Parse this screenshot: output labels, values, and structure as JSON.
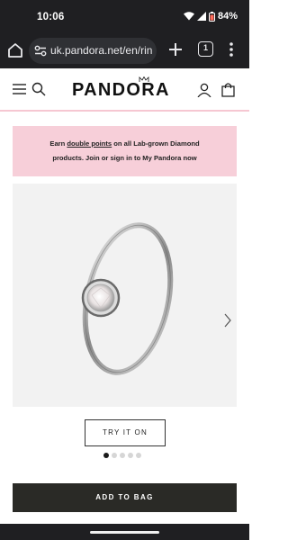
{
  "status_bar": {
    "time": "10:06",
    "battery": "84%"
  },
  "browser": {
    "url": "uk.pandora.net/en/rin",
    "tab_count": "1"
  },
  "header": {
    "logo": "PANDORA"
  },
  "promo": {
    "before": "Earn ",
    "link": "double points",
    "after": " on all Lab-grown Diamond",
    "line2": "products. Join or sign in to My Pandora now"
  },
  "gallery": {
    "dot_count": 5,
    "active_index": 0
  },
  "actions": {
    "try_label": "TRY IT ON",
    "add_label": "ADD TO BAG"
  }
}
